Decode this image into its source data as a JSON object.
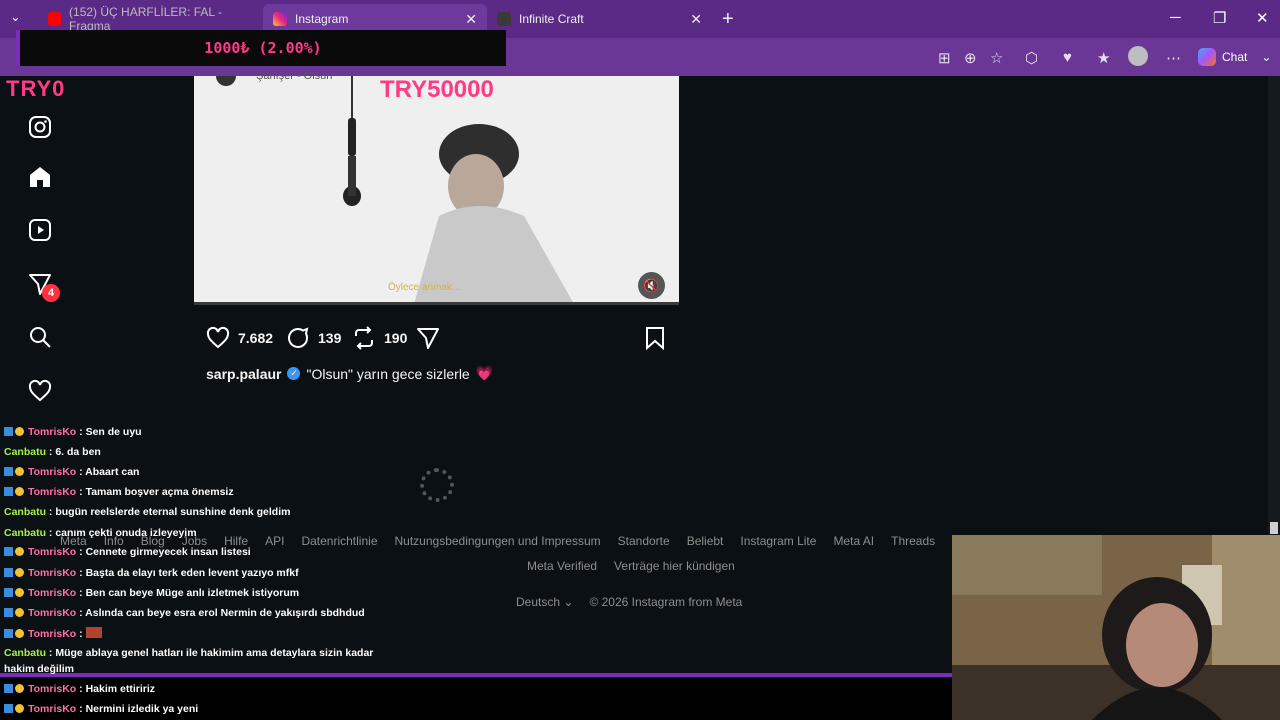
{
  "browser": {
    "tabs": [
      {
        "label": "(152) ÜÇ HARFLİLER: FAL - Fragma",
        "active": false
      },
      {
        "label": "Instagram",
        "active": true
      },
      {
        "label": "Infinite Craft",
        "active": false
      }
    ],
    "new_tab": "+",
    "chat_label": "Chat",
    "accent": "#5b2a86"
  },
  "overlay": {
    "brand": "TRY0",
    "goal": "TRY50000",
    "donation": "1000₺ (2.00%)",
    "accent_pink": "#ff3b88"
  },
  "sidebar": {
    "icons": [
      "instagram-icon",
      "home-icon",
      "reels-icon",
      "direct-messages-icon",
      "search-icon",
      "notifications-icon"
    ],
    "message_badge": "4"
  },
  "post": {
    "song_label": "Şanışer - Olsun",
    "subtitle": "Öylece anmak...",
    "likes": "7.682",
    "comments": "139",
    "reposts": "190",
    "username": "sarp.palaur",
    "caption": "\"Olsun\" yarın gece sizlerle",
    "heart_emoji": "💗"
  },
  "footer": {
    "links": [
      "Meta",
      "Info",
      "Blog",
      "Jobs",
      "Hilfe",
      "API",
      "Datenrichtlinie",
      "Nutzungsbedingungen und Impressum",
      "Standorte",
      "Beliebt",
      "Instagram Lite",
      "Meta AI",
      "Threads"
    ],
    "links2": [
      "Meta Verified",
      "Verträge hier kündigen"
    ],
    "language": "Deutsch",
    "copyright": "© 2026 Instagram from Meta"
  },
  "chat": [
    {
      "user": "TomrisKo",
      "text": " : Sen de uyu"
    },
    {
      "user": "Canbatu",
      "text": " : 6. da ben"
    },
    {
      "user": "TomrisKo",
      "text": " : Abaart can"
    },
    {
      "user": "TomrisKo",
      "text": " : Tamam boşver açma önemsiz"
    },
    {
      "user": "Canbatu",
      "text": " : bugün reelslerde eternal sunshine denk geldim"
    },
    {
      "user": "Canbatu",
      "text": " : canım çekti onuda izleyeyim"
    },
    {
      "user": "TomrisKo",
      "text": " : Cennete girmeyecek insan listesi"
    },
    {
      "user": "TomrisKo",
      "text": " : Başta da elayı terk eden levent yazıyo mfkf"
    },
    {
      "user": "TomrisKo",
      "text": " : Ben can beye Müge anlı izletmek istiyorum"
    },
    {
      "user": "TomrisKo",
      "text": " : Aslında can beye esra erol Nermin de yakışırdı sbdhdud"
    },
    {
      "user": "TomrisKo",
      "text": " : "
    },
    {
      "user": "Canbatu",
      "text": " : Müge ablaya genel hatları ile hakimim ama detaylara sizin kadar"
    },
    {
      "user": "",
      "text": "hakim değilim"
    },
    {
      "user": "TomrisKo",
      "text": " : Hakim ettiririz"
    },
    {
      "user": "TomrisKo",
      "text": " : Nermini izledik ya yeni"
    }
  ]
}
